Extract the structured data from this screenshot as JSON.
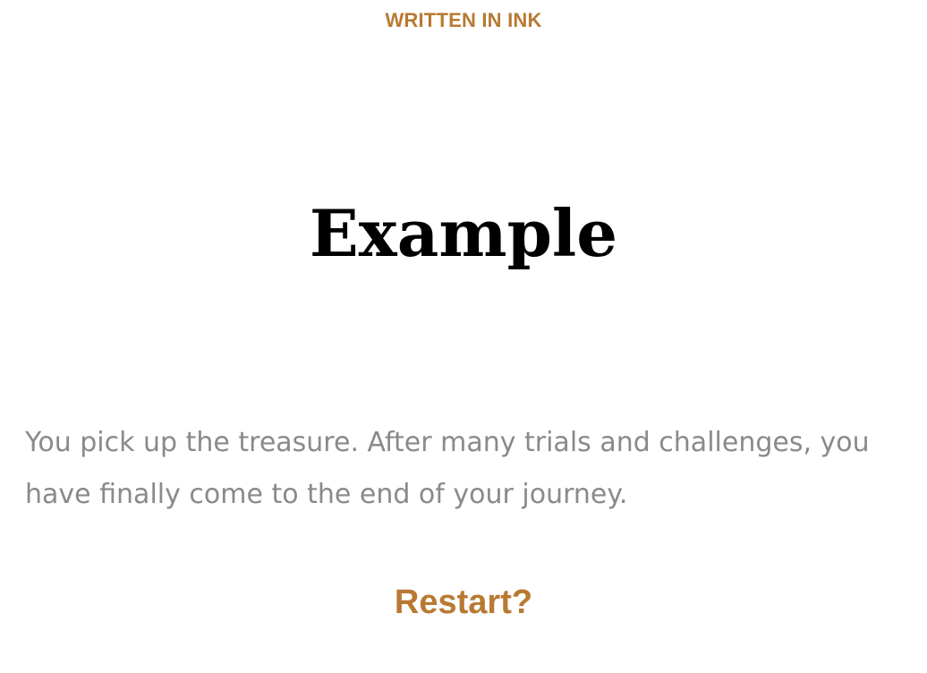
{
  "header": {
    "title": "WRITTEN IN INK"
  },
  "story": {
    "title": "Example",
    "paragraph": "You pick up the treasure. After many trials and challenges, you have finally come to the end of your journey."
  },
  "choices": {
    "restart_label": "Restart?"
  },
  "colors": {
    "accent": "#b87a32",
    "title": "#000000",
    "body_text": "#8a8a8a",
    "background": "#ffffff"
  }
}
